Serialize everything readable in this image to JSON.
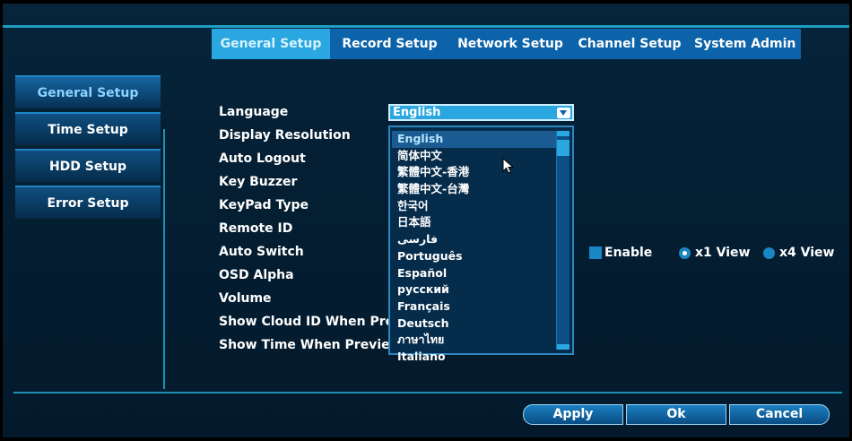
{
  "tabs": [
    {
      "label": "General Setup",
      "active": true
    },
    {
      "label": "Record Setup",
      "active": false
    },
    {
      "label": "Network Setup",
      "active": false
    },
    {
      "label": "Channel Setup",
      "active": false
    },
    {
      "label": "System Admin",
      "active": false
    }
  ],
  "sidebar": {
    "items": [
      {
        "label": "General Setup",
        "active": true
      },
      {
        "label": "Time Setup",
        "active": false
      },
      {
        "label": "HDD Setup",
        "active": false
      },
      {
        "label": "Error Setup",
        "active": false
      }
    ]
  },
  "settings": {
    "labels": [
      "Language",
      "Display Resolution",
      "Auto Logout",
      "Key Buzzer",
      "KeyPad Type",
      "Remote ID",
      "Auto Switch",
      "OSD Alpha",
      "Volume",
      "Show Cloud ID When Pre",
      "Show Time When Previe"
    ]
  },
  "language": {
    "selected": "English",
    "options": [
      "English",
      "简体中文",
      "繁體中文-香港",
      "繁體中文-台灣",
      "한국어",
      "日本語",
      "فارسی",
      "Português",
      "Español",
      "русский",
      "Français",
      "Deutsch",
      "ภาษาไทย",
      "Italiano"
    ]
  },
  "auto_switch": {
    "enable_label": "Enable",
    "x1_label": "x1 View",
    "x4_label": "x4 View",
    "selected_view": "x1 View"
  },
  "buttons": {
    "apply": "Apply",
    "ok": "Ok",
    "cancel": "Cancel"
  },
  "colors": {
    "accent": "#2aa7e0",
    "tab_bar": "#0c63a9",
    "background": "#041d31"
  }
}
